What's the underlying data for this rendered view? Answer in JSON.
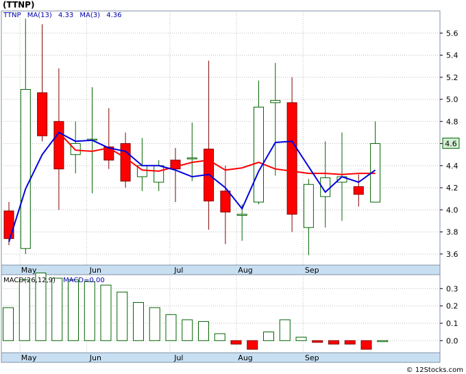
{
  "page": {
    "title": "(TTNP)",
    "watermark": "© 12Stocks.com",
    "colors": {
      "up_stroke": "#006400",
      "down_fill": "#ff0000",
      "down_stroke": "#800000",
      "ma_fast": "#ff0000",
      "ma_slow": "#0000dd",
      "grid": "#bbbbbb",
      "axis_bar": "#c8dff2"
    }
  },
  "price_legend": {
    "ticker": "TTNP",
    "ma13_label": "MA(13)",
    "ma13_value": "4.33",
    "ma3_label": "MA(3)",
    "ma3_value": "4.36"
  },
  "macd_legend": {
    "label": "MACD(26,12,9)",
    "value_label": "MACD=0.00"
  },
  "chart_data": [
    {
      "type": "candlestick",
      "title": "(TTNP)",
      "x_labels": [
        {
          "label": "May",
          "index": 1
        },
        {
          "label": "Jun",
          "index": 5
        },
        {
          "label": "Jul",
          "index": 10
        },
        {
          "label": "Aug",
          "index": 14
        },
        {
          "label": "Sep",
          "index": 18
        }
      ],
      "ylim": [
        3.5,
        5.8
      ],
      "yticks": [
        3.6,
        3.8,
        4.0,
        4.2,
        4.4,
        4.6,
        4.8,
        5.0,
        5.2,
        5.4,
        5.6
      ],
      "last_price": "4.6",
      "grid": true,
      "candles": [
        {
          "open": 3.99,
          "high": 4.07,
          "low": 3.68,
          "close": 3.74
        },
        {
          "open": 3.65,
          "high": 5.73,
          "low": 3.6,
          "close": 5.09
        },
        {
          "open": 5.06,
          "high": 5.68,
          "low": 4.62,
          "close": 4.67
        },
        {
          "open": 4.8,
          "high": 5.28,
          "low": 4.0,
          "close": 4.37
        },
        {
          "open": 4.5,
          "high": 4.8,
          "low": 4.33,
          "close": 4.6
        },
        {
          "open": 4.64,
          "high": 5.11,
          "low": 4.15,
          "close": 4.64
        },
        {
          "open": 4.57,
          "high": 4.92,
          "low": 4.37,
          "close": 4.45
        },
        {
          "open": 4.6,
          "high": 4.7,
          "low": 4.2,
          "close": 4.26
        },
        {
          "open": 4.3,
          "high": 4.65,
          "low": 4.17,
          "close": 4.4
        },
        {
          "open": 4.25,
          "high": 4.45,
          "low": 4.17,
          "close": 4.4
        },
        {
          "open": 4.45,
          "high": 4.56,
          "low": 4.07,
          "close": 4.37
        },
        {
          "open": 4.47,
          "high": 4.79,
          "low": 4.26,
          "close": 4.47
        },
        {
          "open": 4.55,
          "high": 5.35,
          "low": 3.82,
          "close": 4.08
        },
        {
          "open": 4.17,
          "high": 4.4,
          "low": 3.69,
          "close": 3.98
        },
        {
          "open": 3.95,
          "high": 4.05,
          "low": 3.72,
          "close": 3.96
        },
        {
          "open": 4.07,
          "high": 5.17,
          "low": 4.05,
          "close": 4.93
        },
        {
          "open": 4.97,
          "high": 5.33,
          "low": 4.31,
          "close": 4.99
        },
        {
          "open": 4.97,
          "high": 5.2,
          "low": 3.8,
          "close": 3.96
        },
        {
          "open": 3.84,
          "high": 4.28,
          "low": 3.59,
          "close": 4.23
        },
        {
          "open": 4.12,
          "high": 4.62,
          "low": 3.84,
          "close": 4.29
        },
        {
          "open": 4.25,
          "high": 4.7,
          "low": 3.9,
          "close": 4.3
        },
        {
          "open": 4.21,
          "high": 4.32,
          "low": 4.03,
          "close": 4.14
        },
        {
          "open": 4.07,
          "high": 4.8,
          "low": 4.07,
          "close": 4.6
        }
      ],
      "series": [
        {
          "name": "MA(13)",
          "values": [
            null,
            null,
            null,
            4.7,
            4.54,
            4.53,
            4.56,
            4.47,
            4.36,
            4.35,
            4.39,
            4.43,
            4.45,
            4.36,
            4.38,
            4.43,
            4.37,
            4.35,
            4.33,
            4.33,
            4.32,
            4.33,
            4.33
          ]
        },
        {
          "name": "MA(3)",
          "values": [
            3.71,
            4.19,
            4.5,
            4.7,
            4.62,
            4.63,
            4.56,
            4.53,
            4.4,
            4.4,
            4.36,
            4.3,
            4.32,
            4.2,
            4.01,
            4.35,
            4.61,
            4.62,
            4.39,
            4.16,
            4.3,
            4.25,
            4.36
          ]
        }
      ]
    },
    {
      "type": "bar",
      "title": "MACD(26,12,9)",
      "ylim": [
        -0.07,
        0.38
      ],
      "yticks": [
        0.0,
        0.1,
        0.2,
        0.3
      ],
      "grid": true,
      "x_labels": [
        {
          "label": "May",
          "index": 1
        },
        {
          "label": "Jun",
          "index": 5
        },
        {
          "label": "Jul",
          "index": 10
        },
        {
          "label": "Aug",
          "index": 14
        },
        {
          "label": "Sep",
          "index": 18
        }
      ],
      "values": [
        0.19,
        0.35,
        0.39,
        0.36,
        0.35,
        0.34,
        0.32,
        0.28,
        0.22,
        0.19,
        0.15,
        0.12,
        0.11,
        0.04,
        -0.02,
        -0.05,
        0.05,
        0.12,
        0.02,
        -0.01,
        -0.02,
        -0.02,
        -0.05,
        0.0
      ]
    }
  ]
}
